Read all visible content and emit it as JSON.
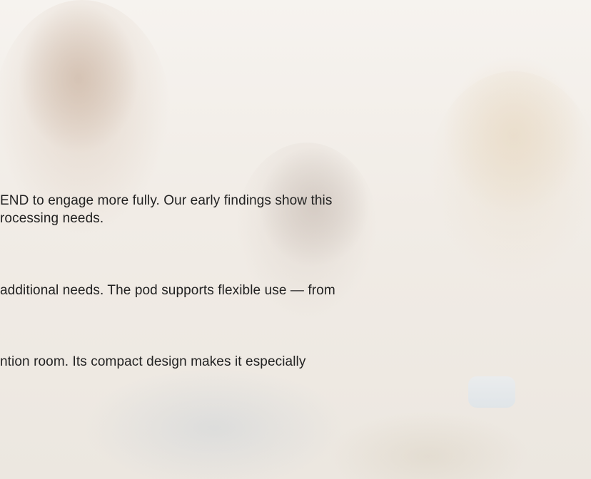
{
  "paragraphs": [
    {
      "lines": [
        "END to engage more fully. Our early findings show this",
        "rocessing needs."
      ]
    },
    {
      "lines": [
        "additional needs. The pod supports flexible use — from"
      ]
    },
    {
      "lines": [
        "ntion room. Its compact design makes it especially"
      ]
    }
  ]
}
